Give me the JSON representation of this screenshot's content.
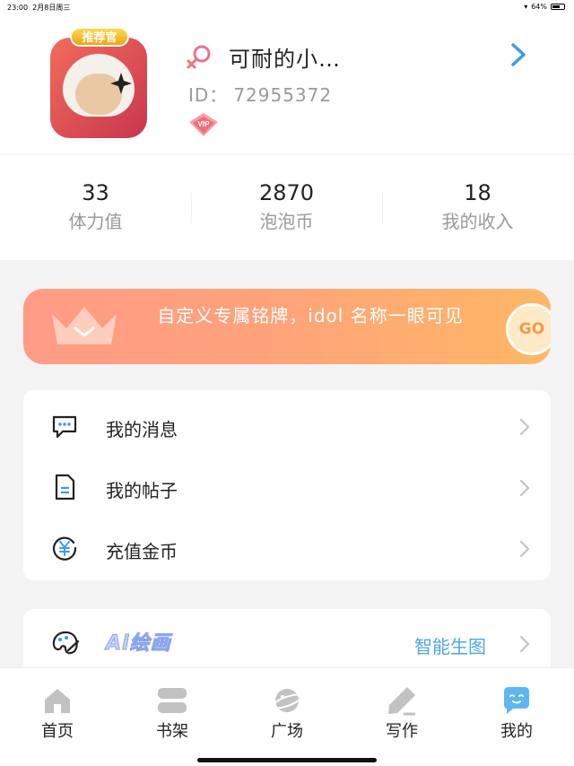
{
  "status_bar": {
    "time": "23:00",
    "date": "2月8日周三",
    "battery": "64%"
  },
  "profile": {
    "avatar_tag": "推荐官",
    "nickname": "可耐的小…",
    "id_label": "ID：",
    "id_value": "72955372",
    "vip_text": "VIP",
    "gender_color": "#f07285"
  },
  "stats": [
    {
      "value": "33",
      "label": "体力值"
    },
    {
      "value": "2870",
      "label": "泡泡币"
    },
    {
      "value": "18",
      "label": "我的收入"
    }
  ],
  "banner": {
    "text": "自定义专属铭牌，idol 名称一眼可见",
    "go": "GO"
  },
  "menu": [
    {
      "label": "我的消息",
      "icon": "message-icon"
    },
    {
      "label": "我的帖子",
      "icon": "document-icon"
    },
    {
      "label": "充值金币",
      "icon": "yuan-coin-icon"
    }
  ],
  "ai": {
    "title": "Ai绘画",
    "subtitle": "智能生图"
  },
  "tabs": [
    {
      "label": "首页",
      "icon": "home-icon"
    },
    {
      "label": "书架",
      "icon": "bookshelf-icon"
    },
    {
      "label": "广场",
      "icon": "planet-icon"
    },
    {
      "label": "写作",
      "icon": "pen-icon"
    },
    {
      "label": "我的",
      "icon": "chat-face-icon",
      "active": true
    }
  ],
  "colors": {
    "accent": "#3d9be9",
    "banner_start": "#ff9b86",
    "banner_end": "#ffb765",
    "tab_inactive": "#c2c2c2"
  }
}
